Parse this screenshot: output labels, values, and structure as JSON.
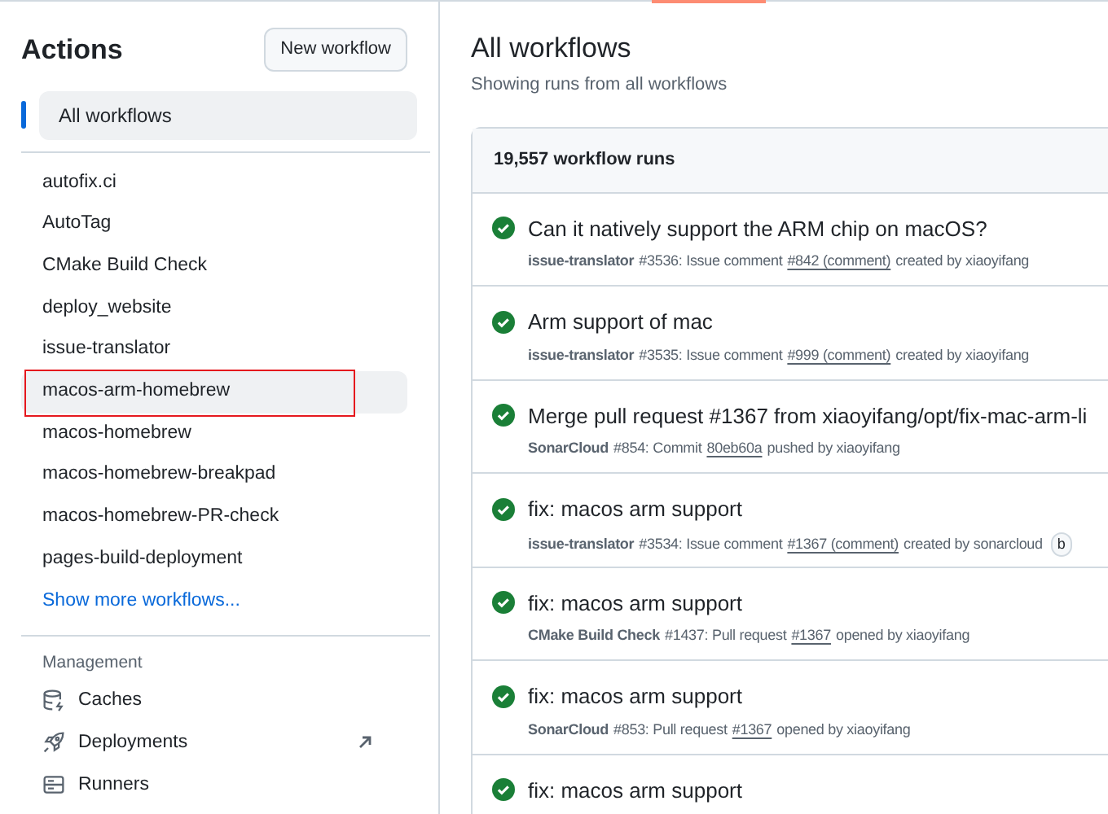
{
  "sidebar": {
    "title": "Actions",
    "new_button": "New workflow",
    "all_workflows": {
      "label": "All workflows",
      "selected": true
    },
    "workflows": [
      {
        "label": "autofix.ci",
        "highlighted": false,
        "annotated": false
      },
      {
        "label": "AutoTag",
        "highlighted": false,
        "annotated": false
      },
      {
        "label": "CMake Build Check",
        "highlighted": false,
        "annotated": false
      },
      {
        "label": "deploy_website",
        "highlighted": false,
        "annotated": false
      },
      {
        "label": "issue-translator",
        "highlighted": false,
        "annotated": false
      },
      {
        "label": "macos-arm-homebrew",
        "highlighted": true,
        "annotated": true
      },
      {
        "label": "macos-homebrew",
        "highlighted": false,
        "annotated": false
      },
      {
        "label": "macos-homebrew-breakpad",
        "highlighted": false,
        "annotated": false
      },
      {
        "label": "macos-homebrew-PR-check",
        "highlighted": false,
        "annotated": false
      },
      {
        "label": "pages-build-deployment",
        "highlighted": false,
        "annotated": false
      }
    ],
    "show_more": "Show more workflows...",
    "management": {
      "heading": "Management",
      "items": [
        {
          "kind": "caches",
          "label": "Caches",
          "external": false
        },
        {
          "kind": "deployments",
          "label": "Deployments",
          "external": true
        },
        {
          "kind": "runners",
          "label": "Runners",
          "external": false
        }
      ]
    }
  },
  "main": {
    "title": "All workflows",
    "subtitle": "Showing runs from all workflows",
    "runs_count": "19,557 workflow runs",
    "runs": [
      {
        "title": "Can it natively support the ARM chip on macOS?",
        "workflow": "issue-translator",
        "event": "#3536: Issue comment",
        "link": "#842 (comment)",
        "suffix": "created by xiaoyifang"
      },
      {
        "title": "Arm support of mac",
        "workflow": "issue-translator",
        "event": "#3535: Issue comment",
        "link": "#999 (comment)",
        "suffix": "created by xiaoyifang"
      },
      {
        "title": "Merge pull request #1367 from xiaoyifang/opt/fix-mac-arm-li",
        "workflow": "SonarCloud",
        "event": "#854: Commit",
        "link": "80eb60a",
        "suffix": "pushed by xiaoyifang"
      },
      {
        "title": "fix: macos arm support",
        "workflow": "issue-translator",
        "event": "#3534: Issue comment",
        "link": "#1367 (comment)",
        "suffix": "created by sonarcloud",
        "badge": "b"
      },
      {
        "title": "fix: macos arm support",
        "workflow": "CMake Build Check",
        "event": "#1437: Pull request",
        "link": "#1367",
        "suffix": "opened by xiaoyifang"
      },
      {
        "title": "fix: macos arm support",
        "workflow": "SonarCloud",
        "event": "#853: Pull request",
        "link": "#1367",
        "suffix": "opened by xiaoyifang"
      },
      {
        "title": "fix: macos arm support"
      }
    ]
  }
}
